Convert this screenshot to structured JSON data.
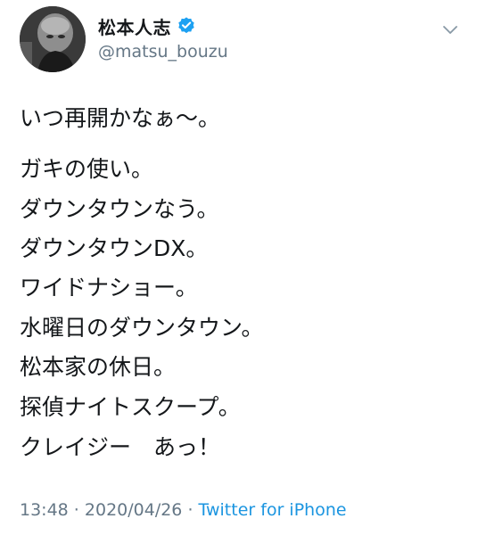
{
  "user": {
    "display_name": "松本人志",
    "handle": "@matsu_bouzu",
    "verified": true
  },
  "tweet": {
    "intro": "いつ再開かなぁ〜。",
    "lines": [
      "ガキの使い。",
      "ダウンタウンなう。",
      "ダウンタウンDX。",
      "ワイドナショー。",
      "水曜日のダウンタウン。",
      "松本家の休日。",
      "探偵ナイトスクープ。",
      "クレイジー　あっ！"
    ]
  },
  "meta": {
    "time": "13:48",
    "separator1": " · ",
    "date": "2020/04/26",
    "separator2": " · ",
    "source": "Twitter for iPhone"
  },
  "colors": {
    "text": "#14171a",
    "muted": "#657786",
    "link": "#1b95e0",
    "verified_badge": "#1da1f2"
  },
  "icons": {
    "verified": "verified-badge-icon",
    "caret": "chevron-down-icon"
  }
}
